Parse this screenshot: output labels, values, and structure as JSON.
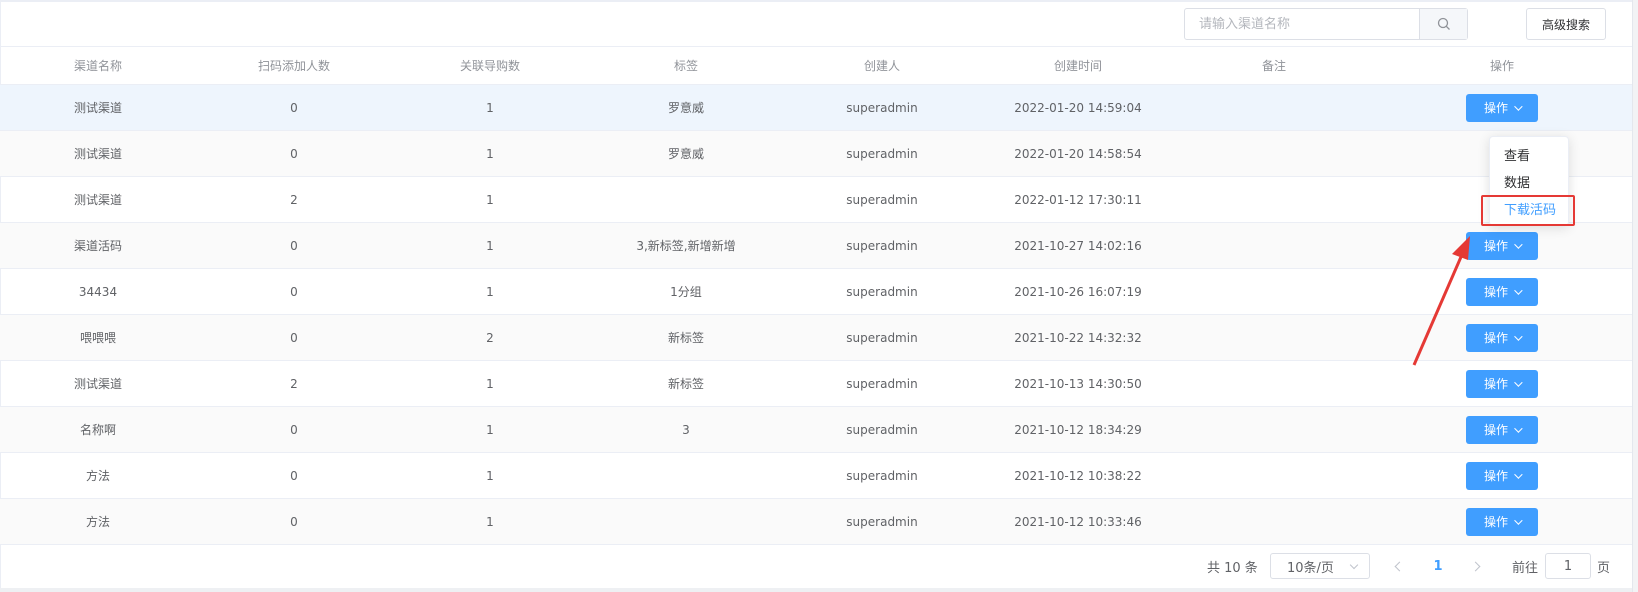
{
  "toolbar": {
    "search_placeholder": "请输入渠道名称",
    "search_value": "",
    "search_icon": "search-icon",
    "advanced_search_label": "高级搜索"
  },
  "table": {
    "columns": [
      "渠道名称",
      "扫码添加人数",
      "关联导购数",
      "标签",
      "创建人",
      "创建时间",
      "备注",
      "操作"
    ],
    "rows": [
      {
        "name": "测试渠道",
        "scans": "0",
        "guides": "1",
        "tags": "罗意威",
        "creator": "superadmin",
        "created": "2022-01-20 14:59:04",
        "note": "",
        "action": "操作"
      },
      {
        "name": "测试渠道",
        "scans": "0",
        "guides": "1",
        "tags": "罗意威",
        "creator": "superadmin",
        "created": "2022-01-20 14:58:54",
        "note": "",
        "action": ""
      },
      {
        "name": "测试渠道",
        "scans": "2",
        "guides": "1",
        "tags": "",
        "creator": "superadmin",
        "created": "2022-01-12 17:30:11",
        "note": "",
        "action": ""
      },
      {
        "name": "渠道活码",
        "scans": "0",
        "guides": "1",
        "tags": "3,新标签,新增新增",
        "creator": "superadmin",
        "created": "2021-10-27 14:02:16",
        "note": "",
        "action": "操作"
      },
      {
        "name": "34434",
        "scans": "0",
        "guides": "1",
        "tags": "1分组",
        "creator": "superadmin",
        "created": "2021-10-26 16:07:19",
        "note": "",
        "action": "操作"
      },
      {
        "name": "喂喂喂",
        "scans": "0",
        "guides": "2",
        "tags": "新标签",
        "creator": "superadmin",
        "created": "2021-10-22 14:32:32",
        "note": "",
        "action": "操作"
      },
      {
        "name": "测试渠道",
        "scans": "2",
        "guides": "1",
        "tags": "新标签",
        "creator": "superadmin",
        "created": "2021-10-13 14:30:50",
        "note": "",
        "action": "操作"
      },
      {
        "name": "名称啊",
        "scans": "0",
        "guides": "1",
        "tags": "3",
        "creator": "superadmin",
        "created": "2021-10-12 18:34:29",
        "note": "",
        "action": "操作"
      },
      {
        "name": "方法",
        "scans": "0",
        "guides": "1",
        "tags": "",
        "creator": "superadmin",
        "created": "2021-10-12 10:38:22",
        "note": "",
        "action": "操作"
      },
      {
        "name": "方法",
        "scans": "0",
        "guides": "1",
        "tags": "",
        "creator": "superadmin",
        "created": "2021-10-12 10:33:46",
        "note": "",
        "action": "操作"
      }
    ]
  },
  "dropdown": {
    "items": [
      "查看",
      "数据",
      "下载活码"
    ],
    "highlighted_index": 2
  },
  "pagination": {
    "total_label": "共 10 条",
    "page_size": "10条/页",
    "current_page": "1",
    "goto_label": "前往",
    "goto_value": "1",
    "page_suffix": "页"
  },
  "colors": {
    "primary": "#409eff",
    "highlight_border": "#e53935",
    "hover_row": "#eef5fd"
  }
}
